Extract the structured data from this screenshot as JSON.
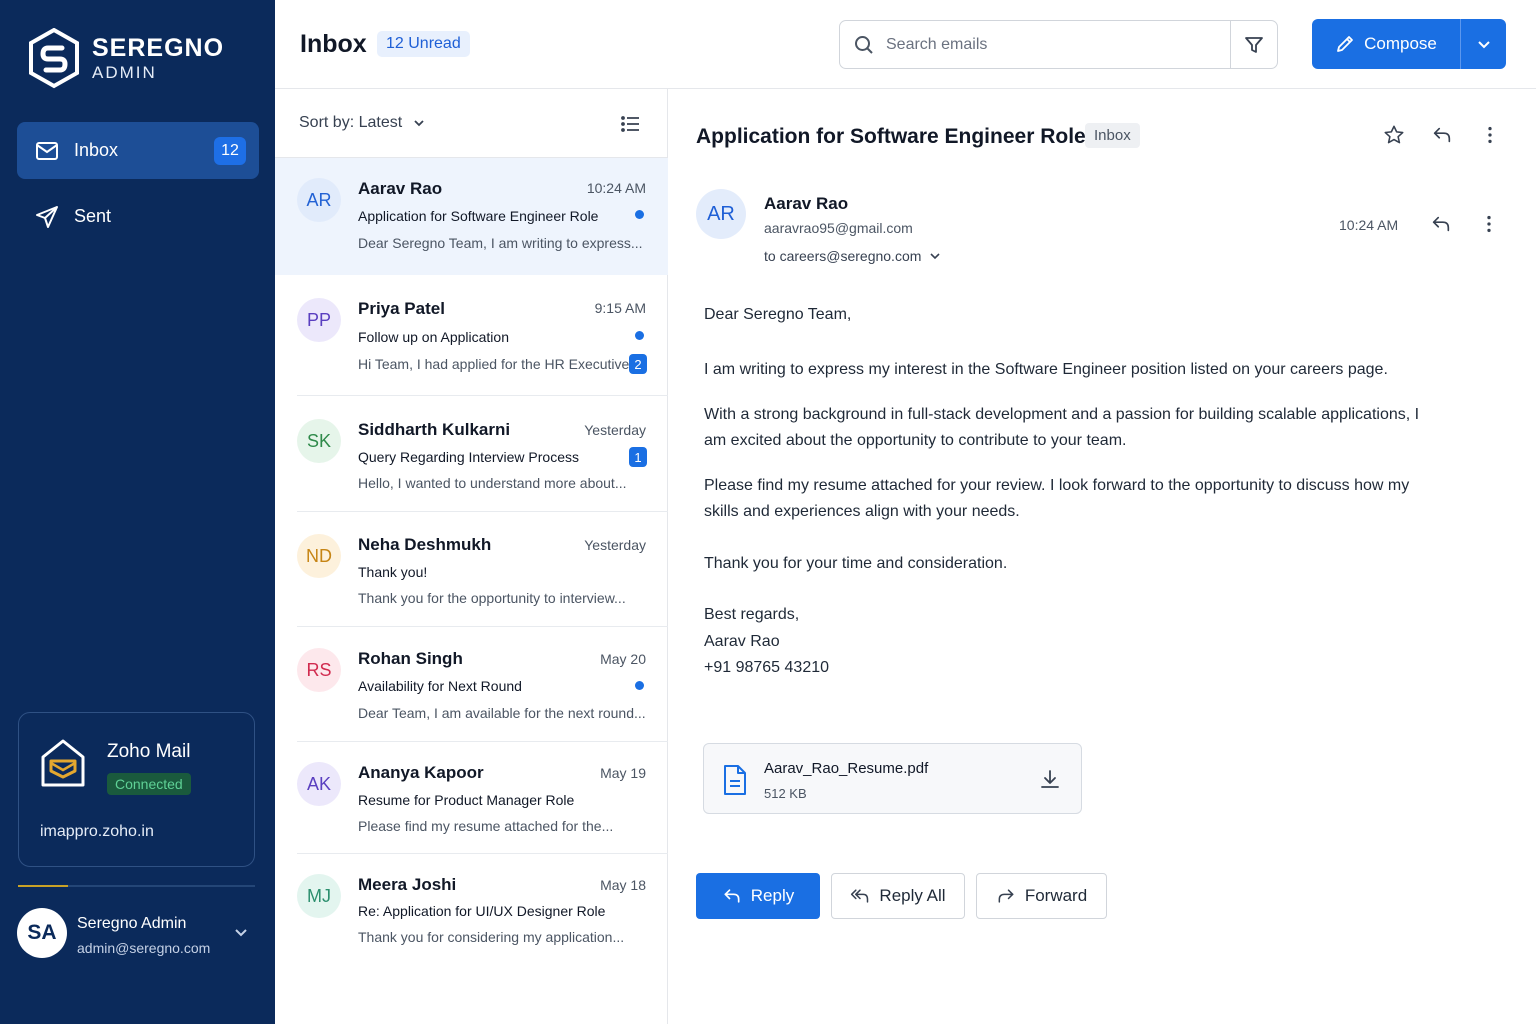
{
  "brand": {
    "name": "SEREGNO",
    "subtitle": "ADMIN"
  },
  "sidebar": {
    "items": [
      {
        "label": "Inbox",
        "icon": "mail-icon",
        "badge": "12",
        "active": true
      },
      {
        "label": "Sent",
        "icon": "send-icon"
      }
    ],
    "integration": {
      "name": "Zoho Mail",
      "status": "Connected",
      "host": "imappro.zoho.in"
    },
    "profile": {
      "initials": "SA",
      "name": "Seregno Admin",
      "email": "admin@seregno.com"
    }
  },
  "header": {
    "title": "Inbox",
    "unread": "12 Unread",
    "search_placeholder": "Search emails",
    "compose_label": "Compose"
  },
  "list": {
    "sort_label": "Sort by: Latest",
    "emails": [
      {
        "initials": "AR",
        "sender": "Aarav Rao",
        "time": "10:24 AM",
        "subject": "Application for Software Engineer Role",
        "preview": "Dear Seregno Team, I am writing to express...",
        "unread_dot": true
      },
      {
        "initials": "PP",
        "sender": "Priya Patel",
        "time": "9:15 AM",
        "subject": "Follow up on Application",
        "preview": "Hi Team, I had applied for the HR Executive.",
        "unread_dot": true,
        "count": "2"
      },
      {
        "initials": "SK",
        "sender": "Siddharth Kulkarni",
        "time": "Yesterday",
        "subject": "Query Regarding Interview Process",
        "preview": "Hello, I wanted to understand more about...",
        "count": "1"
      },
      {
        "initials": "ND",
        "sender": "Neha Deshmukh",
        "time": "Yesterday",
        "subject": "Thank you!",
        "preview": "Thank you for the opportunity to interview..."
      },
      {
        "initials": "RS",
        "sender": "Rohan Singh",
        "time": "May 20",
        "subject": "Availability for Next Round",
        "preview": "Dear Team, I am available for the next round...",
        "unread_dot": true
      },
      {
        "initials": "AK",
        "sender": "Ananya Kapoor",
        "time": "May 19",
        "subject": "Resume for Product Manager Role",
        "preview": "Please find my resume attached for the..."
      },
      {
        "initials": "MJ",
        "sender": "Meera Joshi",
        "time": "May 18",
        "subject": "Re: Application for UI/UX Designer Role",
        "preview": "Thank you for considering my application..."
      }
    ]
  },
  "message": {
    "subject": "Application for Software Engineer Role",
    "folder": "Inbox",
    "sender_initials": "AR",
    "sender_name": "Aarav Rao",
    "sender_email": "aaravrao95@gmail.com",
    "to": "to careers@seregno.com",
    "time": "10:24 AM",
    "greeting": "Dear Seregno Team,",
    "p1": "I am writing to express my interest in the Software Engineer position listed on your careers page.",
    "p2": "With a strong background in full-stack development and a passion for building scalable applications, I am excited about the opportunity to contribute to your team.",
    "p3": "Please find my resume attached for your review. I look forward to the opportunity to discuss how my skills and experiences align with your needs.",
    "p4": "Thank you for your time and consideration.",
    "signoff": "Best regards,",
    "sig_name": "Aarav Rao",
    "sig_phone": "+91 98765 43210",
    "attachment": {
      "name": "Aarav_Rao_Resume.pdf",
      "size": "512 KB"
    },
    "actions": {
      "reply": "Reply",
      "reply_all": "Reply All",
      "forward": "Forward"
    }
  },
  "colors": {
    "sidebar_bg": "#0b2a5b",
    "accent": "#1a6fe3",
    "selected_bg": "#eef4fd",
    "connected": "#5fd196"
  }
}
